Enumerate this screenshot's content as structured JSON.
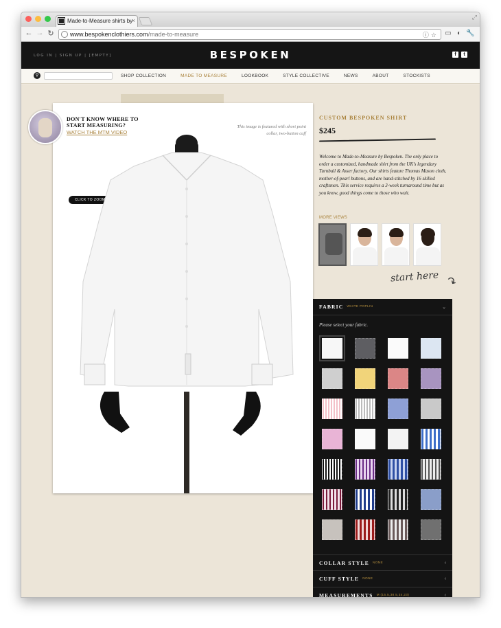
{
  "browser": {
    "tab_title": "Made-to-Measure shirts by",
    "tab_close": "×",
    "url_domain": "www.bespokenclothiers.com",
    "url_path": "/made-to-measure"
  },
  "header": {
    "account": "LOG IN | SIGN UP | [EMPTY]",
    "logo": "BESPOKEN",
    "social": [
      "f",
      "t"
    ]
  },
  "nav": {
    "items": [
      "SHOP COLLECTION",
      "MADE TO MEASURE",
      "LOOKBOOK",
      "STYLE COLLECTIVE",
      "NEWS",
      "ABOUT",
      "STOCKISTS"
    ],
    "active": "MADE TO MEASURE"
  },
  "promo": {
    "title": "DON'T KNOW WHERE TO START MEASURING?",
    "link": "WATCH THE MTM VIDEO"
  },
  "photo": {
    "caption": "This image is featured with short point collar, two-button cuff",
    "zoom_tip": "CLICK TO ZOOM"
  },
  "product": {
    "title": "CUSTOM BESPOKEN SHIRT",
    "price": "$245",
    "description": "Welcome to Made-to-Measure by Bespoken. The only place to order a customized, handmade shirt from the UK's legendary Turnbull & Asser factory. Our shirts feature Thomas Mason cloth, mother-of-pearl buttons, and are hand-stitched by 16 skilled craftsmen. This service requires a 3-week turnaround time but as you know, good things come to those who wait.",
    "more_views": "MORE VIEWS",
    "start_here": "start here"
  },
  "options": {
    "fabric": {
      "label": "FABRIC",
      "value": "WHITE POPLIN",
      "prompt": "Please select your fabric."
    },
    "collar": {
      "label": "COLLAR STYLE",
      "value": "NONE"
    },
    "cuff": {
      "label": "CUFF STYLE",
      "value": "NONE"
    },
    "measurements": {
      "label": "MEASUREMENTS",
      "value": "M (15.5,38.5,34,23)"
    }
  },
  "colors": {
    "accent": "#a9823b",
    "header_bg": "#151515",
    "panel_bg": "#141414",
    "page_bg": "#ece5d8"
  }
}
